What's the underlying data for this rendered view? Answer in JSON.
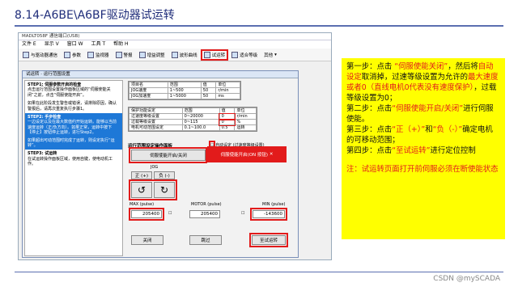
{
  "slide": {
    "title": "8.14-A6BE\\A6BF驱动器试运转",
    "watermark": "CSDN @mySCADA"
  },
  "app": {
    "window_title": "MADLT058F  通信端口(USB)",
    "menu": [
      "文件 E",
      "显示 V",
      "窗口 W",
      "工具 T",
      "帮助 H"
    ],
    "toolbar": [
      "与驱动器通信",
      "参数",
      "监视器",
      "警报",
      "增益调整",
      "波形曲线",
      "试运转",
      "适合等级",
      "其他"
    ],
    "active_tool": "试运转"
  },
  "dialog": {
    "title": "试运转 · 运行范围设置",
    "steps": [
      {
        "head": "STEP1: 伺服参数开启的检查",
        "body": "点击运行范围设置操作面板区域的“伺服使能关闭”之前，点击“伺服使能开启”。",
        "blue": false
      },
      {
        "head": "",
        "body": "如果在此阶段发生警告或错误，请排除原因，确认警报后，请再次重复执行步骤1。",
        "blue": false
      },
      {
        "head": "STEP2: 手步检查",
        "body": "一边设定以及在最大数值约开始运转。能够以当前速度运转（正/负方向）。如果正常，运转中按下【停止】按钮停止运转，进行Step2。",
        "blue": true
      },
      {
        "head": "",
        "body": "如果超出可动范围时完成了运转，则设定执行“运转”。",
        "blue": true
      },
      {
        "head": "STEP3: 试运转",
        "body": "在试运转操作面板区域，使用自键，使电动机工作。",
        "blue": false
      }
    ],
    "speed_table": {
      "headers": [
        "项目名",
        "范围",
        "值",
        "单位"
      ],
      "rows": [
        [
          "JOG速度",
          "1~500",
          "50",
          "r/min"
        ],
        [
          "JOG加速度",
          "1~5000",
          "50",
          "ms"
        ]
      ]
    },
    "protect_table": {
      "headers": [
        "保护功能设定",
        "范围",
        "值",
        "单位"
      ],
      "rows": [
        [
          "过速度等级设置",
          "0~20000",
          "0",
          "r/min"
        ],
        [
          "过载等级设置",
          "0~115",
          "0",
          "%"
        ],
        [
          "电机可动范围设定",
          "0.1~100.0",
          "0.5",
          "运转"
        ]
      ]
    },
    "panel_label": "运行范围设定操作面板",
    "auto_set_label": "自动设定 (过速度等级设置)",
    "servo_off_button": "伺服使能开启/关闭",
    "servo_on_button": "伺服使能开启(ON 按钮)",
    "jog_label": "JOG",
    "pos_button": "正 (+)",
    "neg_button": "负 (-)",
    "max_label": "MAX (pulse)",
    "motor_label": "MOTOR (pulse)",
    "min_label": "MIN (pulse)",
    "max_value": "205400",
    "motor_value": "205400",
    "min_value": "-143600",
    "close_button": "关闭",
    "skip_button": "跳过",
    "trial_button": "至试运转"
  },
  "instructions": {
    "step1_prefix": "第一步：点击 ",
    "step1_red1": "“伺服使能关闭”",
    "step1_mid1": "，然后将",
    "step1_red2": "自动设定",
    "step1_mid2": "取消掉，过速等级设置为允许的",
    "step1_red3": "最大速度或者0（直线电机0代表没有速度保护）",
    "step1_suffix": "，过载等级设置为0；",
    "step2_prefix": "第二步：点击",
    "step2_red": "“伺服使能开启/关闭”",
    "step2_suffix": "进行伺服使能。",
    "step3_prefix": "第三步：点击",
    "step3_red1": "“正（+）”",
    "step3_mid": "和",
    "step3_red2": "“负（-）”",
    "step3_suffix": "确定电机的可移动范围；",
    "step4_prefix": "第四步：点击",
    "step4_red": "“至试运转”",
    "step4_suffix": "进行定位控制",
    "note": "注：试运转页面打开前伺服必须在断使能状态"
  }
}
